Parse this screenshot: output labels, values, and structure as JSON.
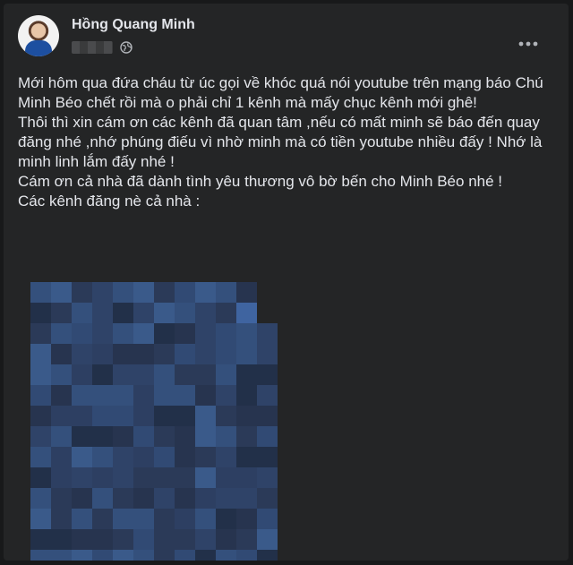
{
  "post": {
    "author": "Hồng Quang Minh",
    "privacy_icon": "globe-icon",
    "menu_icon": "more-options-icon",
    "paragraphs": [
      "Mới hôm qua đứa cháu từ úc gọi về khóc quá nói youtube trên mạng báo Chú Minh Béo chết rồi mà o phải chỉ 1 kênh mà mấy chục kênh mới ghê!",
      "Thôi thì xin cám ơn các kênh đã quan tâm ,nếu có mất minh sẽ báo đến quay đăng nhé ,nhớ phúng điếu vì nhờ minh mà có tiền youtube nhiều đấy ! Nhớ là minh linh lắm đấy nhé !",
      "Cám ơn cả nhà đã dành tình yêu thương vô bờ bến cho Minh Béo nhé !",
      "Các kênh đăng nè cả nhà :"
    ]
  },
  "colors": {
    "background": "#18191a",
    "card": "#242526",
    "text_primary": "#e4e6eb",
    "text_secondary": "#b0b3b8"
  }
}
